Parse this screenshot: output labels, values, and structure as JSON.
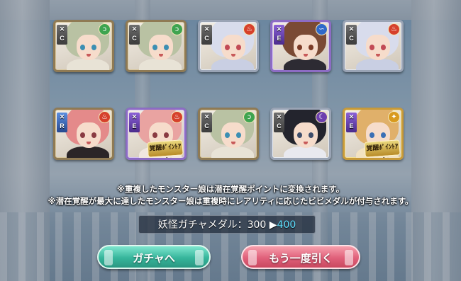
{
  "cards": [
    {
      "rank": "C",
      "element": "wind",
      "hair": "#b9c2a3",
      "eyes": "#3d8fb3",
      "body": "#e8e3d6",
      "frame": "r-bronze",
      "awaken": false
    },
    {
      "rank": "C",
      "element": "wind",
      "hair": "#b9c2a3",
      "eyes": "#3d8fb3",
      "body": "#e8e3d6",
      "frame": "r-bronze",
      "awaken": false
    },
    {
      "rank": "C",
      "element": "fire",
      "hair": "#d8dcec",
      "eyes": "#c24a55",
      "body": "#c9cfe3",
      "frame": "r-silver",
      "awaken": false
    },
    {
      "rank": "E",
      "element": "water",
      "hair": "#7a4a34",
      "eyes": "#7b3a25",
      "body": "#2d2b33",
      "frame": "r-purple",
      "awaken": false
    },
    {
      "rank": "C",
      "element": "fire",
      "hair": "#d8dcec",
      "eyes": "#c24a55",
      "body": "#c9cfe3",
      "frame": "r-silver",
      "awaken": false
    },
    {
      "rank": "R",
      "element": "fire",
      "hair": "#e48a8a",
      "eyes": "#8a3b42",
      "body": "#2b2527",
      "frame": "r-bronze",
      "awaken": false
    },
    {
      "rank": "E",
      "element": "fire",
      "hair": "#e9a3a1",
      "eyes": "#8a3b42",
      "body": "#f1e7e0",
      "frame": "r-purple",
      "awaken": true
    },
    {
      "rank": "C",
      "element": "wind",
      "hair": "#b9c2a3",
      "eyes": "#3d8fb3",
      "body": "#e8e3d6",
      "frame": "r-bronze",
      "awaken": false
    },
    {
      "rank": "C",
      "element": "dark",
      "hair": "#23242d",
      "eyes": "#3e4d6a",
      "body": "#e9e9ef",
      "frame": "r-silver",
      "awaken": false
    },
    {
      "rank": "E",
      "element": "light",
      "hair": "#e0b06a",
      "eyes": "#3b6fb5",
      "body": "#f2e2c2",
      "frame": "r-gold",
      "awaken": true
    }
  ],
  "awaken_label": "覚醒ﾎﾟｲﾝﾄｱｯﾌﾟ!",
  "element_glyphs": {
    "wind": "ↄ",
    "fire": "♨",
    "water": "∽",
    "dark": "☾",
    "light": "✦"
  },
  "notices": [
    "※重複したモンスター娘は潜在覚醒ポイントに変換されます。",
    "※潜在覚醒が最大に達したモンスター娘は重複時にレアリティに応じたビビメダルが付与されます。"
  ],
  "medal": {
    "label": "妖怪ガチャメダル：300 ▶",
    "after": "400"
  },
  "buttons": {
    "gacha": "ガチャへ",
    "again": "もう一度引く"
  }
}
